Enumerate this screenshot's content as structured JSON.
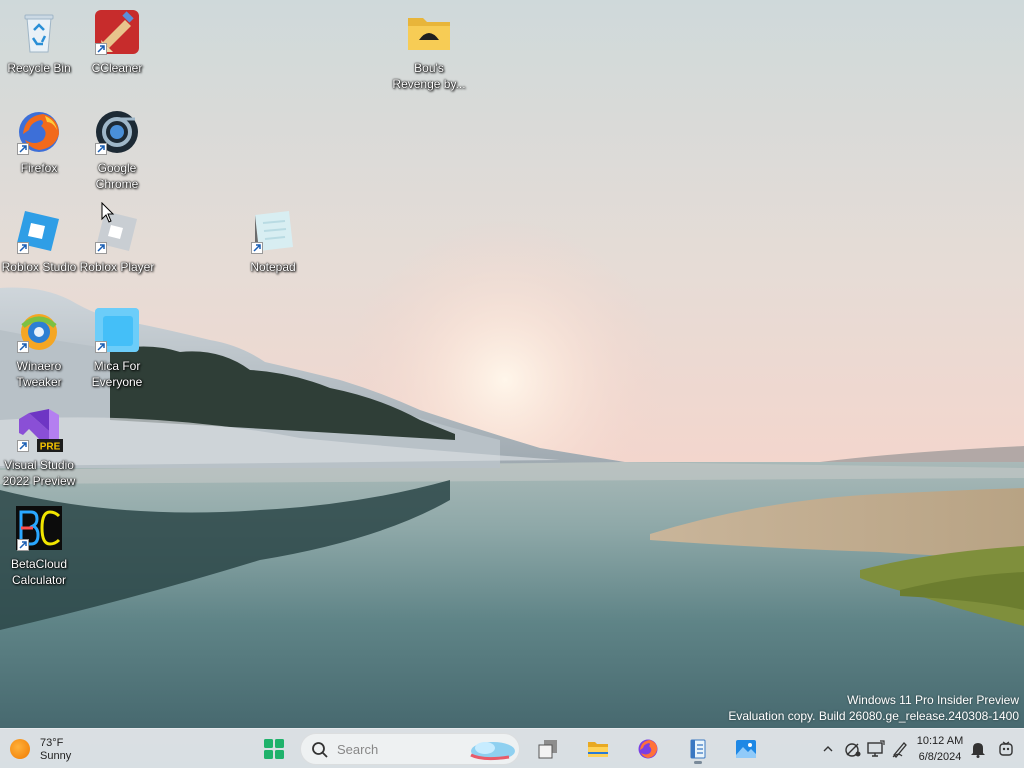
{
  "desktop": {
    "icons": [
      {
        "label": "Recycle Bin",
        "icon": "recycle-bin-icon"
      },
      {
        "label": "CCleaner",
        "icon": "ccleaner-icon"
      },
      {
        "label": "Bou's\nRevenge by...",
        "icon": "folder-icon"
      },
      {
        "label": "Firefox",
        "icon": "firefox-icon"
      },
      {
        "label": "Google\nChrome",
        "icon": "chrome-icon"
      },
      {
        "label": "Roblox Studio",
        "icon": "roblox-studio-icon"
      },
      {
        "label": "Roblox Player",
        "icon": "roblox-player-icon"
      },
      {
        "label": "Notepad",
        "icon": "notepad-icon"
      },
      {
        "label": "Winaero\nTweaker",
        "icon": "winaero-tweaker-icon"
      },
      {
        "label": "Mica For\nEveryone",
        "icon": "mica-icon"
      },
      {
        "label": "Visual Studio\n2022 Preview",
        "icon": "visual-studio-icon",
        "badge": "PRE"
      },
      {
        "label": "BetaCloud\nCalculator",
        "icon": "betacloud-calculator-icon"
      }
    ]
  },
  "watermark": {
    "line1": "Windows 11 Pro Insider Preview",
    "line2": "Evaluation copy. Build 26080.ge_release.240308-1400"
  },
  "taskbar": {
    "weather": {
      "temp": "73°F",
      "condition": "Sunny",
      "icon": "sun-icon"
    },
    "search_placeholder": "Search",
    "pinned": [
      "start-icon",
      "task-view-icon",
      "file-explorer-icon",
      "firefox-icon",
      "notepad-icon",
      "photos-icon"
    ],
    "tray": {
      "icons": [
        "chevron-up-icon",
        "network-icon",
        "display-icon",
        "pen-icon",
        "notification-bell-icon",
        "copilot-icon"
      ],
      "time": "10:12 AM",
      "date": "6/8/2024"
    }
  },
  "colors": {
    "taskbar": "#dce2e7",
    "accent": "#0067c0",
    "label_text": "#ffffff"
  }
}
